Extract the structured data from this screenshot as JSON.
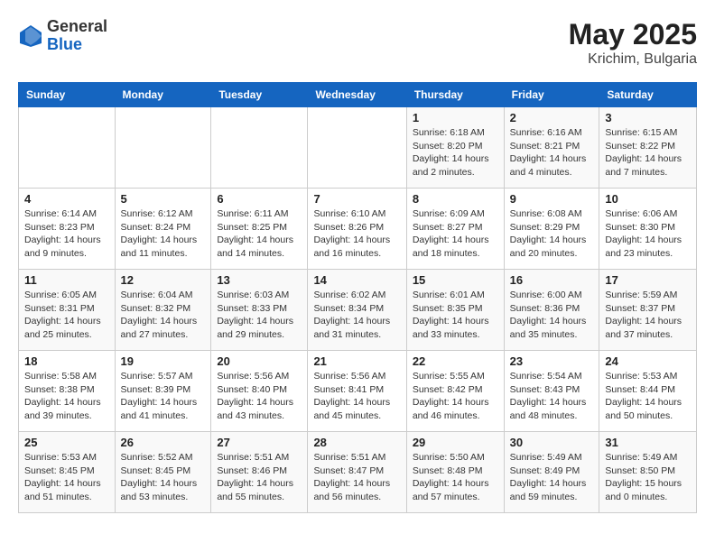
{
  "header": {
    "logo_general": "General",
    "logo_blue": "Blue",
    "title": "May 2025",
    "subtitle": "Krichim, Bulgaria"
  },
  "weekdays": [
    "Sunday",
    "Monday",
    "Tuesday",
    "Wednesday",
    "Thursday",
    "Friday",
    "Saturday"
  ],
  "weeks": [
    [
      {
        "day": "",
        "info": ""
      },
      {
        "day": "",
        "info": ""
      },
      {
        "day": "",
        "info": ""
      },
      {
        "day": "",
        "info": ""
      },
      {
        "day": "1",
        "info": "Sunrise: 6:18 AM\nSunset: 8:20 PM\nDaylight: 14 hours\nand 2 minutes."
      },
      {
        "day": "2",
        "info": "Sunrise: 6:16 AM\nSunset: 8:21 PM\nDaylight: 14 hours\nand 4 minutes."
      },
      {
        "day": "3",
        "info": "Sunrise: 6:15 AM\nSunset: 8:22 PM\nDaylight: 14 hours\nand 7 minutes."
      }
    ],
    [
      {
        "day": "4",
        "info": "Sunrise: 6:14 AM\nSunset: 8:23 PM\nDaylight: 14 hours\nand 9 minutes."
      },
      {
        "day": "5",
        "info": "Sunrise: 6:12 AM\nSunset: 8:24 PM\nDaylight: 14 hours\nand 11 minutes."
      },
      {
        "day": "6",
        "info": "Sunrise: 6:11 AM\nSunset: 8:25 PM\nDaylight: 14 hours\nand 14 minutes."
      },
      {
        "day": "7",
        "info": "Sunrise: 6:10 AM\nSunset: 8:26 PM\nDaylight: 14 hours\nand 16 minutes."
      },
      {
        "day": "8",
        "info": "Sunrise: 6:09 AM\nSunset: 8:27 PM\nDaylight: 14 hours\nand 18 minutes."
      },
      {
        "day": "9",
        "info": "Sunrise: 6:08 AM\nSunset: 8:29 PM\nDaylight: 14 hours\nand 20 minutes."
      },
      {
        "day": "10",
        "info": "Sunrise: 6:06 AM\nSunset: 8:30 PM\nDaylight: 14 hours\nand 23 minutes."
      }
    ],
    [
      {
        "day": "11",
        "info": "Sunrise: 6:05 AM\nSunset: 8:31 PM\nDaylight: 14 hours\nand 25 minutes."
      },
      {
        "day": "12",
        "info": "Sunrise: 6:04 AM\nSunset: 8:32 PM\nDaylight: 14 hours\nand 27 minutes."
      },
      {
        "day": "13",
        "info": "Sunrise: 6:03 AM\nSunset: 8:33 PM\nDaylight: 14 hours\nand 29 minutes."
      },
      {
        "day": "14",
        "info": "Sunrise: 6:02 AM\nSunset: 8:34 PM\nDaylight: 14 hours\nand 31 minutes."
      },
      {
        "day": "15",
        "info": "Sunrise: 6:01 AM\nSunset: 8:35 PM\nDaylight: 14 hours\nand 33 minutes."
      },
      {
        "day": "16",
        "info": "Sunrise: 6:00 AM\nSunset: 8:36 PM\nDaylight: 14 hours\nand 35 minutes."
      },
      {
        "day": "17",
        "info": "Sunrise: 5:59 AM\nSunset: 8:37 PM\nDaylight: 14 hours\nand 37 minutes."
      }
    ],
    [
      {
        "day": "18",
        "info": "Sunrise: 5:58 AM\nSunset: 8:38 PM\nDaylight: 14 hours\nand 39 minutes."
      },
      {
        "day": "19",
        "info": "Sunrise: 5:57 AM\nSunset: 8:39 PM\nDaylight: 14 hours\nand 41 minutes."
      },
      {
        "day": "20",
        "info": "Sunrise: 5:56 AM\nSunset: 8:40 PM\nDaylight: 14 hours\nand 43 minutes."
      },
      {
        "day": "21",
        "info": "Sunrise: 5:56 AM\nSunset: 8:41 PM\nDaylight: 14 hours\nand 45 minutes."
      },
      {
        "day": "22",
        "info": "Sunrise: 5:55 AM\nSunset: 8:42 PM\nDaylight: 14 hours\nand 46 minutes."
      },
      {
        "day": "23",
        "info": "Sunrise: 5:54 AM\nSunset: 8:43 PM\nDaylight: 14 hours\nand 48 minutes."
      },
      {
        "day": "24",
        "info": "Sunrise: 5:53 AM\nSunset: 8:44 PM\nDaylight: 14 hours\nand 50 minutes."
      }
    ],
    [
      {
        "day": "25",
        "info": "Sunrise: 5:53 AM\nSunset: 8:45 PM\nDaylight: 14 hours\nand 51 minutes."
      },
      {
        "day": "26",
        "info": "Sunrise: 5:52 AM\nSunset: 8:45 PM\nDaylight: 14 hours\nand 53 minutes."
      },
      {
        "day": "27",
        "info": "Sunrise: 5:51 AM\nSunset: 8:46 PM\nDaylight: 14 hours\nand 55 minutes."
      },
      {
        "day": "28",
        "info": "Sunrise: 5:51 AM\nSunset: 8:47 PM\nDaylight: 14 hours\nand 56 minutes."
      },
      {
        "day": "29",
        "info": "Sunrise: 5:50 AM\nSunset: 8:48 PM\nDaylight: 14 hours\nand 57 minutes."
      },
      {
        "day": "30",
        "info": "Sunrise: 5:49 AM\nSunset: 8:49 PM\nDaylight: 14 hours\nand 59 minutes."
      },
      {
        "day": "31",
        "info": "Sunrise: 5:49 AM\nSunset: 8:50 PM\nDaylight: 15 hours\nand 0 minutes."
      }
    ]
  ]
}
